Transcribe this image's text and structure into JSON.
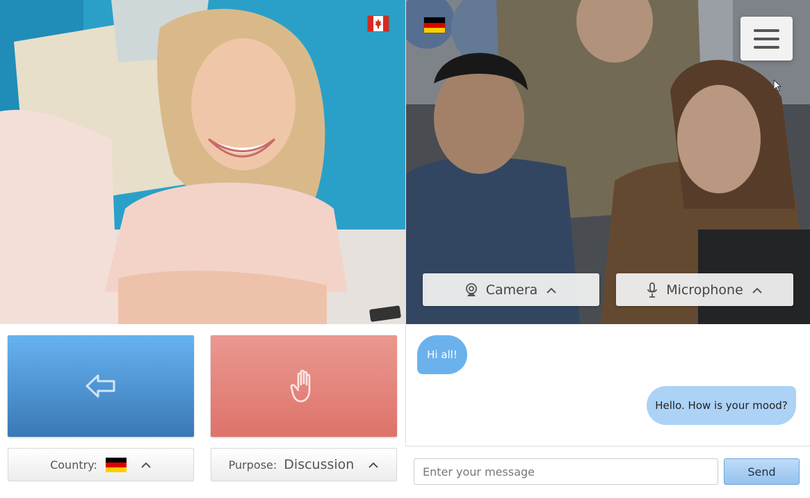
{
  "controls": {
    "camera_label": "Camera",
    "microphone_label": "Microphone"
  },
  "filters": {
    "country_label": "Country:",
    "purpose_label": "Purpose:",
    "purpose_value": "Discussion"
  },
  "chat": {
    "messages": [
      {
        "text": "Hi all!",
        "side": "left"
      },
      {
        "text": "Hello. How is your mood?",
        "side": "right"
      }
    ],
    "input_placeholder": "Enter your message",
    "send_label": "Send"
  },
  "icons": {
    "menu": "hamburger-menu-icon",
    "back": "arrow-left-icon",
    "stop": "raised-hand-icon",
    "camera": "webcam-icon",
    "microphone": "microphone-icon",
    "chevron": "chevron-up-icon"
  },
  "flags": {
    "partner_country": "canada",
    "own_country": "germany"
  },
  "colors": {
    "back_button": "#4a8fd3",
    "stop_button": "#e3837b",
    "bubble_incoming": "#6bb2ec",
    "bubble_outgoing": "#acd2f5",
    "send_button": "#a6cdf2"
  }
}
